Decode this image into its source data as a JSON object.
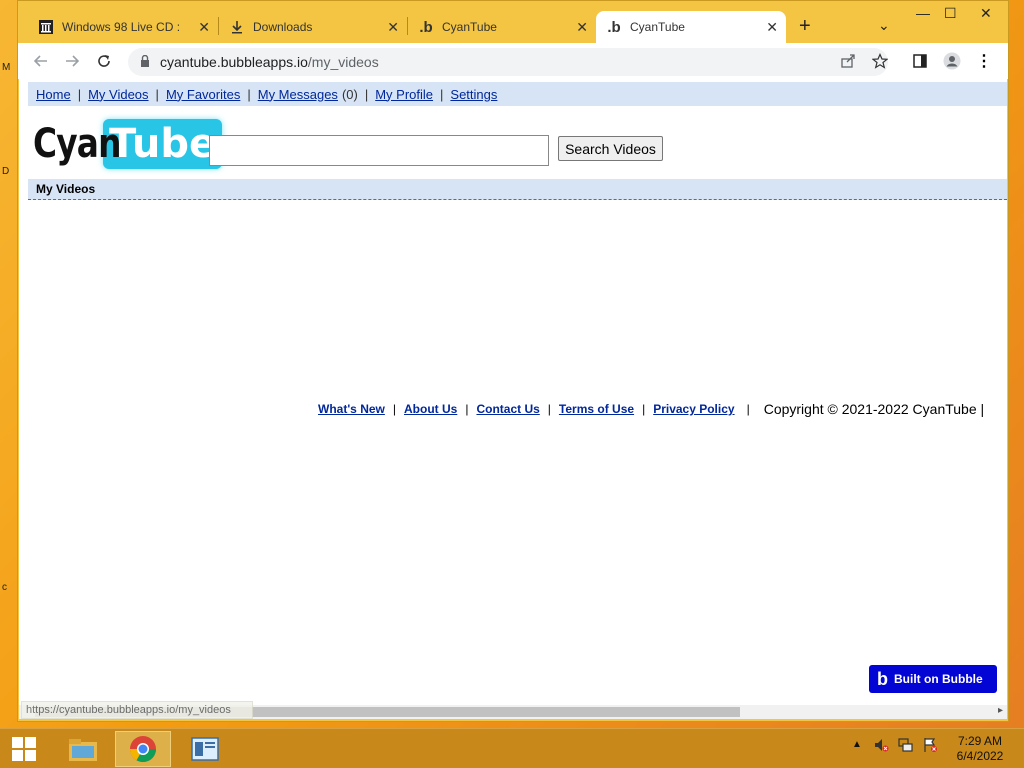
{
  "browser": {
    "tabs": [
      {
        "title": "Windows 98 Live CD : F",
        "favicon": "archive-icon"
      },
      {
        "title": "Downloads",
        "favicon": "download-icon"
      },
      {
        "title": "CyanTube",
        "favicon": "bubble-b-icon"
      },
      {
        "title": "CyanTube",
        "favicon": "bubble-b-icon",
        "active": true
      }
    ],
    "url_host": "cyantube.bubbleapps.io",
    "url_path": "/my_videos",
    "status_url": "https://cyantube.bubbleapps.io/my_videos"
  },
  "nav": {
    "home": "Home",
    "my_videos": "My Videos",
    "my_favorites": "My Favorites",
    "my_messages": "My Messages",
    "messages_count": "(0)",
    "my_profile": "My Profile",
    "settings": "Settings"
  },
  "logo": {
    "part1": "Cyan",
    "part2": "Tube"
  },
  "search": {
    "value": "",
    "button_label": "Search Videos"
  },
  "section_title": "My Videos",
  "footer": {
    "whats_new": "What's New",
    "about_us": "About Us",
    "contact_us": "Contact Us",
    "terms": "Terms of Use",
    "privacy": "Privacy Policy",
    "copyright": "Copyright © 2021-2022 CyanTube |"
  },
  "badge": {
    "label": "Built on Bubble"
  },
  "taskbar": {
    "time": "7:29 AM",
    "date": "6/4/2022"
  },
  "colors": {
    "nav_bg": "#d6e4f5",
    "link": "#00279b",
    "logo_cyan": "#29c5e6",
    "badge_bg": "#0205d3",
    "window_frame": "#f4c542"
  }
}
